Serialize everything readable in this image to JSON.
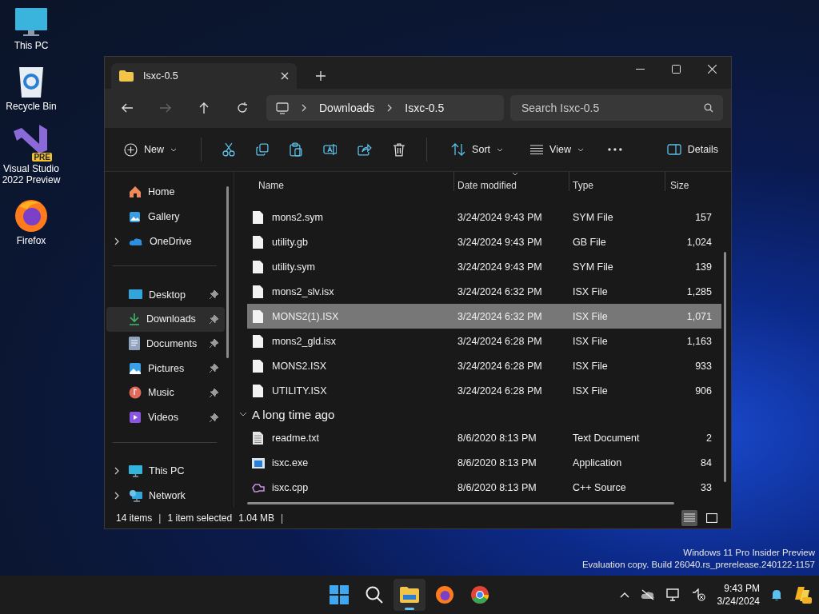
{
  "desktop_icons": [
    {
      "kind": "pc",
      "label": "This PC"
    },
    {
      "kind": "bin",
      "label": "Recycle Bin"
    },
    {
      "kind": "vs",
      "label": "Visual Studio 2022 Preview",
      "badge": "PRE"
    },
    {
      "kind": "firefox",
      "label": "Firefox"
    }
  ],
  "window": {
    "tabs": [
      {
        "label": "Isxc-0.5",
        "selected": true
      }
    ],
    "nav": [
      {
        "kind": "back",
        "disabled": false
      },
      {
        "kind": "forward",
        "disabled": true
      },
      {
        "kind": "up",
        "disabled": false
      },
      {
        "kind": "refresh",
        "disabled": false
      }
    ],
    "address": [
      "Downloads",
      "Isxc-0.5"
    ],
    "search": {
      "placeholder": "Search Isxc-0.5"
    },
    "toolbar": {
      "new": "New",
      "sort": "Sort",
      "view": "View",
      "details": "Details"
    },
    "sidebar": [
      [
        {
          "kind": "home",
          "label": "Home",
          "expandable": false,
          "pinned": false,
          "selected": false
        },
        {
          "kind": "gallery",
          "label": "Gallery",
          "expandable": false,
          "pinned": false,
          "selected": false
        },
        {
          "kind": "cloud",
          "label": "OneDrive",
          "expandable": true,
          "pinned": false,
          "selected": false
        }
      ],
      [
        {
          "kind": "desktop",
          "label": "Desktop",
          "expandable": false,
          "pinned": true,
          "selected": false
        },
        {
          "kind": "download",
          "label": "Downloads",
          "expandable": false,
          "pinned": true,
          "selected": true
        },
        {
          "kind": "documents",
          "label": "Documents",
          "expandable": false,
          "pinned": true,
          "selected": false
        },
        {
          "kind": "pictures",
          "label": "Pictures",
          "expandable": false,
          "pinned": true,
          "selected": false
        },
        {
          "kind": "music",
          "label": "Music",
          "expandable": false,
          "pinned": true,
          "selected": false
        },
        {
          "kind": "videos",
          "label": "Videos",
          "expandable": false,
          "pinned": true,
          "selected": false
        }
      ],
      [
        {
          "kind": "pc",
          "label": "This PC",
          "expandable": true,
          "pinned": false,
          "selected": false
        },
        {
          "kind": "network",
          "label": "Network",
          "expandable": true,
          "pinned": false,
          "selected": false
        }
      ]
    ],
    "columns": [
      {
        "label": "Name",
        "sorted": false
      },
      {
        "label": "Date modified",
        "sorted": true
      },
      {
        "label": "Type",
        "sorted": false
      },
      {
        "label": "Size",
        "sorted": false
      }
    ],
    "rows": [
      {
        "kind": "blank",
        "name": "mons2.sym",
        "date": "3/24/2024 9:43 PM",
        "type": "SYM File",
        "size": "157",
        "selected": false
      },
      {
        "kind": "blank",
        "name": "utility.gb",
        "date": "3/24/2024 9:43 PM",
        "type": "GB File",
        "size": "1,024",
        "selected": false
      },
      {
        "kind": "blank",
        "name": "utility.sym",
        "date": "3/24/2024 9:43 PM",
        "type": "SYM File",
        "size": "139",
        "selected": false
      },
      {
        "kind": "blank",
        "name": "mons2_slv.isx",
        "date": "3/24/2024 6:32 PM",
        "type": "ISX File",
        "size": "1,285",
        "selected": false
      },
      {
        "kind": "blank",
        "name": "MONS2(1).ISX",
        "date": "3/24/2024 6:32 PM",
        "type": "ISX File",
        "size": "1,071",
        "selected": true
      },
      {
        "kind": "blank",
        "name": "mons2_gld.isx",
        "date": "3/24/2024 6:28 PM",
        "type": "ISX File",
        "size": "1,163",
        "selected": false
      },
      {
        "kind": "blank",
        "name": "MONS2.ISX",
        "date": "3/24/2024 6:28 PM",
        "type": "ISX File",
        "size": "933",
        "selected": false
      },
      {
        "kind": "blank",
        "name": "UTILITY.ISX",
        "date": "3/24/2024 6:28 PM",
        "type": "ISX File",
        "size": "906",
        "selected": false
      }
    ],
    "group": {
      "label": "A long time ago",
      "expanded": true,
      "rows": [
        {
          "kind": "text",
          "name": "readme.txt",
          "date": "8/6/2020 8:13 PM",
          "type": "Text Document",
          "size": "2",
          "selected": false
        },
        {
          "kind": "exe",
          "name": "isxc.exe",
          "date": "8/6/2020 8:13 PM",
          "type": "Application",
          "size": "84",
          "selected": false
        },
        {
          "kind": "cpp",
          "name": "isxc.cpp",
          "date": "8/6/2020 8:13 PM",
          "type": "C++ Source",
          "size": "33",
          "selected": false
        }
      ]
    },
    "status": {
      "count": "14 items",
      "selection": "1 item selected",
      "size": "1.04 MB",
      "separators": [
        "|",
        "|"
      ]
    },
    "views": [
      {
        "kind": "details",
        "selected": true
      },
      {
        "kind": "tiles",
        "selected": false
      }
    ]
  },
  "watermark": [
    "Windows 11 Pro Insider Preview",
    "Evaluation copy. Build 26040.rs_prerelease.240122-1157"
  ],
  "taskbar": {
    "apps": [
      {
        "kind": "start",
        "active": false
      },
      {
        "kind": "search",
        "active": false
      },
      {
        "kind": "explorer",
        "active": true
      },
      {
        "kind": "firefox",
        "active": false
      },
      {
        "kind": "chrome",
        "active": false
      }
    ],
    "time": "9:43 PM",
    "date": "3/24/2024"
  }
}
